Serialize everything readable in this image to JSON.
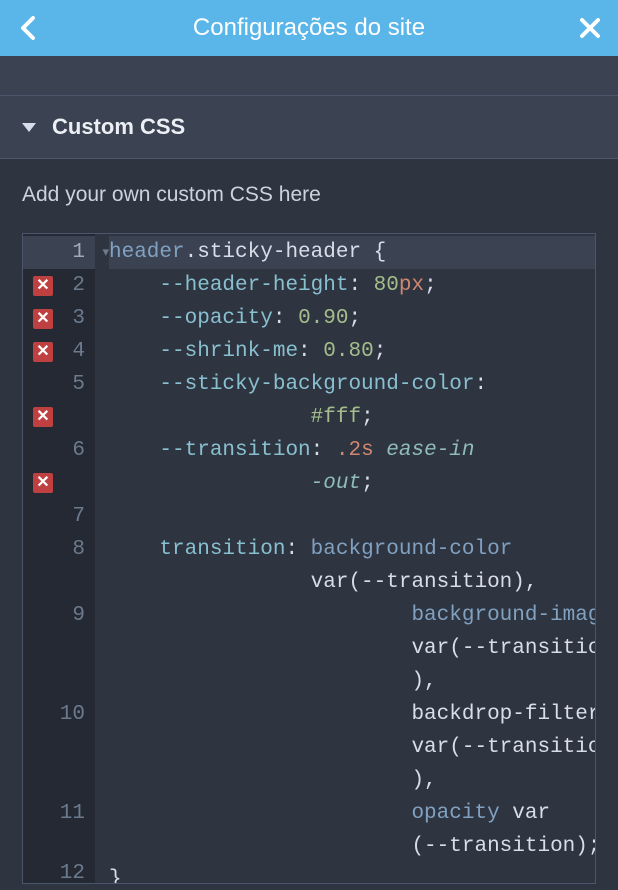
{
  "header": {
    "title": "Configurações do site"
  },
  "section": {
    "title": "Custom CSS"
  },
  "description": "Add your own custom CSS here",
  "editor": {
    "lines": [
      {
        "n": 1,
        "error": false,
        "fold": true,
        "active": true,
        "wrap": 0,
        "tokens": [
          [
            "tag",
            "header"
          ],
          [
            "class",
            ".sticky-header"
          ],
          [
            "punc",
            " {"
          ]
        ]
      },
      {
        "n": 2,
        "error": true,
        "wrap": 0,
        "indent": 1,
        "tokens": [
          [
            "prop",
            "--header-height"
          ],
          [
            "punc",
            ": "
          ],
          [
            "num",
            "80"
          ],
          [
            "unit",
            "px"
          ],
          [
            "punc",
            ";"
          ]
        ]
      },
      {
        "n": 3,
        "error": true,
        "wrap": 0,
        "indent": 1,
        "tokens": [
          [
            "prop",
            "--opacity"
          ],
          [
            "punc",
            ": "
          ],
          [
            "num",
            "0.90"
          ],
          [
            "punc",
            ";"
          ]
        ]
      },
      {
        "n": 4,
        "error": true,
        "wrap": 0,
        "indent": 1,
        "tokens": [
          [
            "prop",
            "--shrink-me"
          ],
          [
            "punc",
            ": "
          ],
          [
            "num",
            "0.80"
          ],
          [
            "punc",
            ";"
          ]
        ]
      },
      {
        "n": 5,
        "error": true,
        "erroff": 1,
        "wrap": 0,
        "indent": 1,
        "tokens": [
          [
            "prop",
            "--sticky-background-color"
          ],
          [
            "punc",
            ": "
          ]
        ]
      },
      {
        "n": "",
        "wrap": 2,
        "tokens": [
          [
            "hex",
            "#fff"
          ],
          [
            "punc",
            ";"
          ]
        ]
      },
      {
        "n": 6,
        "error": true,
        "erroff": 1,
        "wrap": 0,
        "indent": 1,
        "tokens": [
          [
            "prop",
            "--transition"
          ],
          [
            "punc",
            ": "
          ],
          [
            "time",
            ".2s"
          ],
          [
            "punc",
            " "
          ],
          [
            "ident",
            "ease-in"
          ]
        ]
      },
      {
        "n": "",
        "wrap": 2,
        "tokens": [
          [
            "ident",
            "-out"
          ],
          [
            "punc",
            ";"
          ]
        ]
      },
      {
        "n": 7,
        "wrap": 0,
        "tokens": []
      },
      {
        "n": 8,
        "wrap": 0,
        "indent": 1,
        "tokens": [
          [
            "prop",
            "transition"
          ],
          [
            "punc",
            ": "
          ],
          [
            "kw",
            "background-color"
          ]
        ]
      },
      {
        "n": "",
        "wrap": 2,
        "tokens": [
          [
            "punc",
            "var(--transition), "
          ]
        ]
      },
      {
        "n": 9,
        "wrap": 3,
        "tokens": [
          [
            "kw",
            "background-image"
          ]
        ]
      },
      {
        "n": "",
        "wrap": 3,
        "tokens": [
          [
            "punc",
            "var(--transition"
          ]
        ]
      },
      {
        "n": "",
        "wrap": 3,
        "tokens": [
          [
            "punc",
            "), "
          ]
        ]
      },
      {
        "n": 10,
        "wrap": 3,
        "tokens": [
          [
            "punc",
            "backdrop-filter "
          ]
        ]
      },
      {
        "n": "",
        "wrap": 3,
        "tokens": [
          [
            "punc",
            "var(--transition"
          ]
        ]
      },
      {
        "n": "",
        "wrap": 3,
        "tokens": [
          [
            "punc",
            "), "
          ]
        ]
      },
      {
        "n": 11,
        "wrap": 3,
        "tokens": [
          [
            "kw",
            "opacity"
          ],
          [
            "punc",
            " var"
          ]
        ]
      },
      {
        "n": "",
        "wrap": 3,
        "tokens": [
          [
            "punc",
            "(--transition);"
          ]
        ]
      },
      {
        "n": 12,
        "wrap": 0,
        "partial": true,
        "tokens": [
          [
            "punc",
            "}"
          ]
        ]
      }
    ]
  }
}
